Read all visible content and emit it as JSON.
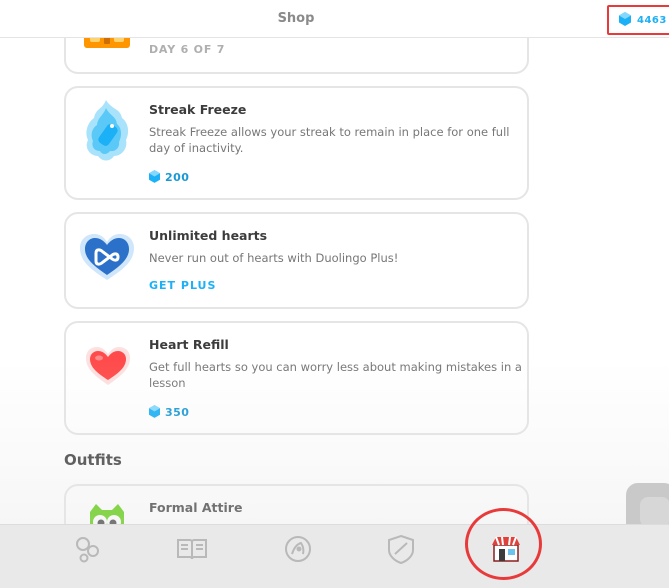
{
  "header": {
    "title": "Shop",
    "gem_count": "4463"
  },
  "shop_items": {
    "streak_challenge": {
      "day_label": "DAY 6 OF 7"
    },
    "streak_freeze": {
      "title": "Streak Freeze",
      "description": "Streak Freeze allows your streak to remain in place for one full day of inactivity.",
      "price": "200"
    },
    "unlimited_hearts": {
      "title": "Unlimited hearts",
      "description": "Never run out of hearts with Duolingo Plus!",
      "action": "GET PLUS"
    },
    "heart_refill": {
      "title": "Heart Refill",
      "description": "Get full hearts so you can worry less about making mistakes in a lesson",
      "price": "350"
    }
  },
  "outfits": {
    "heading": "Outfits",
    "items": [
      {
        "title": "Formal Attire"
      }
    ]
  },
  "tabbar": {
    "tabs": [
      {
        "icon": "learn-icon"
      },
      {
        "icon": "stories-icon"
      },
      {
        "icon": "profile-icon"
      },
      {
        "icon": "leaderboard-icon"
      },
      {
        "icon": "shop-icon",
        "active": true
      }
    ]
  },
  "colors": {
    "gem_blue": "#1cb0f6",
    "highlight_red": "#e83a3a",
    "heart_red": "#ff4b4b"
  }
}
